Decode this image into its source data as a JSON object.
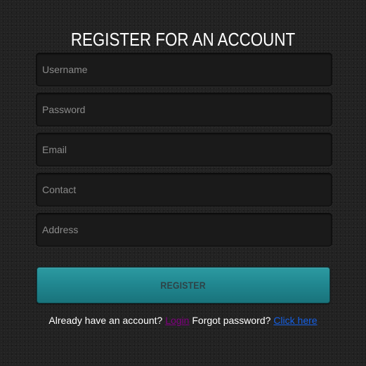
{
  "page_title": "REGISTER FOR AN ACCOUNT",
  "fields": [
    {
      "name": "username",
      "placeholder": "Username",
      "value": ""
    },
    {
      "name": "password",
      "placeholder": "Password",
      "value": ""
    },
    {
      "name": "email",
      "placeholder": "Email",
      "value": ""
    },
    {
      "name": "contact",
      "placeholder": "Contact",
      "value": ""
    },
    {
      "name": "address",
      "placeholder": "Address",
      "value": ""
    }
  ],
  "register_button_label": "REGISTER",
  "footer": {
    "have_account_text": "Already have an account?",
    "login_link": "Login",
    "forgot_text": "Forgot password?",
    "click_here_link": "Click here"
  },
  "colors": {
    "background": "#222222",
    "button": "#218891",
    "login_link": "#800080",
    "click_here_link": "#1560e6"
  }
}
